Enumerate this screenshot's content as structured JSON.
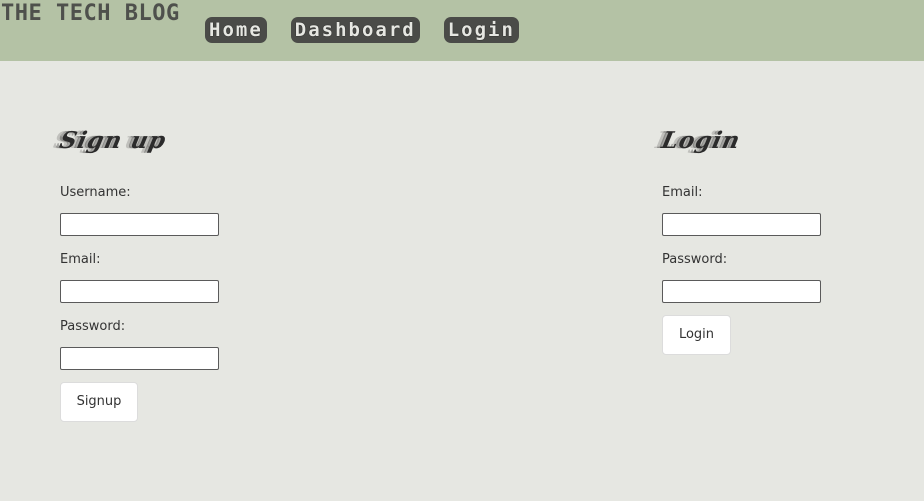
{
  "header": {
    "site_title": "THE TECH BLOG",
    "nav": [
      "Home",
      "Dashboard",
      "Login"
    ]
  },
  "signup": {
    "title": "Sign up",
    "username_label": "Username:",
    "email_label": "Email:",
    "password_label": "Password:",
    "username_value": "",
    "email_value": "",
    "password_value": "",
    "button": "Signup"
  },
  "login": {
    "title": "Login",
    "email_label": "Email:",
    "password_label": "Password:",
    "email_value": "",
    "password_value": "",
    "button": "Login"
  },
  "colors": {
    "header_bg": "#b4c2a5",
    "page_bg": "#e6e7e2",
    "nav_button_bg": "#4a4b48"
  }
}
